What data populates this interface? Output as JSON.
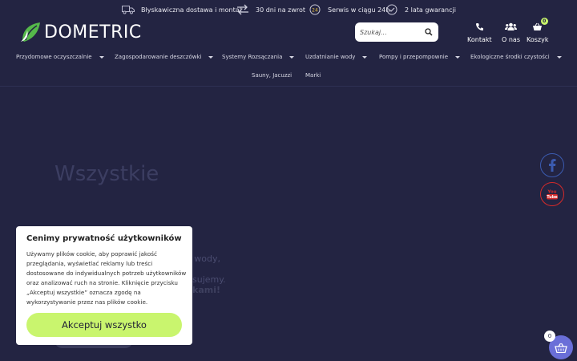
{
  "topbar": {
    "perks": [
      {
        "icon": "delivery-truck-icon",
        "text": "Błyskawiczna dostawa i montaż"
      },
      {
        "icon": "return-arrows-icon",
        "text": "30 dni na zwrot"
      },
      {
        "icon": "service-badge-icon",
        "text": "Serwis w ciągu 24h"
      },
      {
        "icon": "guarantee-check-icon",
        "text": "2 lata gwarancji"
      }
    ]
  },
  "header": {
    "logo_text": "DOMETRIC",
    "search_placeholder": "Szukaj...",
    "contact_label": "Kontakt",
    "about_label": "O nas",
    "cart_label": "Koszyk",
    "cart_count": "0"
  },
  "nav": {
    "items": [
      "Przydomowe oczyszczalnie",
      "Zagospodarowanie deszczówki",
      "Systemy Rozsączania",
      "Uzdatnianie wody",
      "Pompy i przepompownie",
      "Ekologiczne środki czystości",
      "Sauny, Jacuzzi",
      "Marki"
    ]
  },
  "hero": {
    "headline_line1": "Wszystkie",
    "headline_line2": "",
    "text_fragment1": "e wody,",
    "text_fragment2": "sujemy.",
    "text_fragment3": "kami!"
  },
  "cookie": {
    "title": "Cenimy prywatność użytkowników",
    "body": "Używamy plików cookie, aby poprawić jakość przeglądania, wyświetlać reklamy lub treści dostosowane do indywidualnych potrzeb użytkowników oraz analizować ruch na stronie. Kliknięcie przycisku „Akceptuj wszystkie” oznacza zgodę na wykorzystywanie przez nas plików cookie.",
    "accept_label": "Akceptuj wszystko"
  },
  "floating_cart": {
    "count": "0"
  },
  "colors": {
    "background": "#232442",
    "accent": "#c9f56e",
    "cart": "#6a6fd8"
  }
}
